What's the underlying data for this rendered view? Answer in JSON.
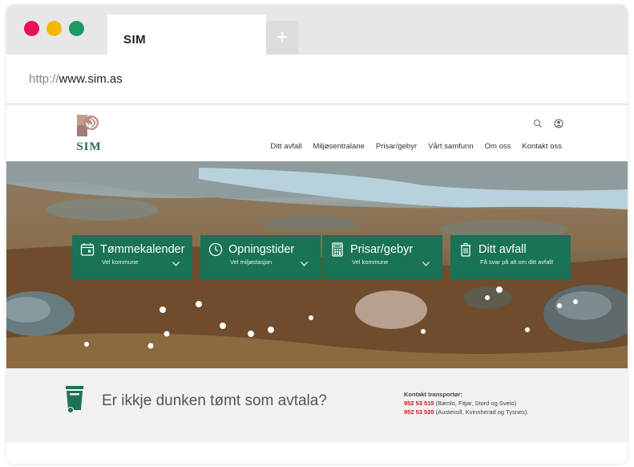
{
  "browser": {
    "tab_title": "SIM",
    "new_tab_symbol": "+",
    "url_protocol": "http://",
    "url_host": "www.sim.as",
    "window_dots": [
      "#e8115b",
      "#f5b800",
      "#1a9d62"
    ]
  },
  "site": {
    "logo_text": "SIM",
    "header_icons": [
      "search-icon",
      "user-icon"
    ],
    "nav": [
      "Ditt avfall",
      "Miljøsentralane",
      "Prisar/gebyr",
      "Vårt samfunn",
      "Om oss",
      "Kontakt oss"
    ],
    "accent_color": "#1a7257",
    "cards": [
      {
        "title": "Tømmekalender",
        "subtitle": "Vel kommune",
        "icon": "calendar-icon",
        "has_dropdown": true
      },
      {
        "title": "Opningstider",
        "subtitle": "Vel miljøstasjon",
        "icon": "clock-icon",
        "has_dropdown": true
      },
      {
        "title": "Prisar/gebyr",
        "subtitle": "Vel kommune",
        "icon": "calculator-icon",
        "has_dropdown": true
      },
      {
        "title": "Ditt avfall",
        "subtitle": "Få svar på alt om ditt avfall!",
        "icon": "trash-icon",
        "has_dropdown": false
      }
    ],
    "bin_question": "Er ikkje dunken tømt som avtala?",
    "contact": {
      "label": "Kontakt transportør:",
      "lines": [
        {
          "phone": "952 53 515",
          "areas": " (Bømlo, Fitjar, Stord og Sveio)"
        },
        {
          "phone": "952 53 520",
          "areas": " (Austevoll, Kvinnherad og Tysnes)."
        }
      ]
    }
  }
}
